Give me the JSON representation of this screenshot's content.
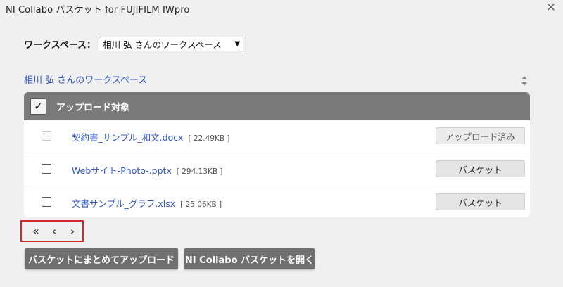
{
  "window": {
    "title": "NI Collabo バスケット for FUJIFILM IWpro",
    "close_glyph": "✕"
  },
  "workspace": {
    "label": "ワークスペース：",
    "selected": "相川 弘 さんのワークスペース",
    "link": "相川 弘 さんのワークスペース"
  },
  "table": {
    "header_check": "✓",
    "header_label": "アップロード対象",
    "rows": [
      {
        "name": "契約書_サンプル_和文.docx",
        "size": "[ 22.49KB ]",
        "button": "アップロード済み",
        "checked": false,
        "disabled": true
      },
      {
        "name": "Webサイト-Photo-.pptx",
        "size": "[ 294.13KB ]",
        "button": "バスケット",
        "checked": false,
        "disabled": false
      },
      {
        "name": "文書サンプル_グラフ.xlsx",
        "size": "[ 25.06KB ]",
        "button": "バスケット",
        "checked": false,
        "disabled": false
      }
    ]
  },
  "pager": {
    "first": "«",
    "prev": "‹",
    "next": "›"
  },
  "actions": {
    "upload_all": "バスケットにまとめてアップロード",
    "open_basket": "NI Collabo バスケットを開く"
  },
  "icons": {
    "close": "close-icon",
    "sort": "sort-icon",
    "check": "checkmark-icon"
  },
  "colors": {
    "link": "#2f55c5",
    "header_bg": "#7a7a7a",
    "button_dark": "#6f6f6f",
    "pager_border": "#d9262e"
  }
}
